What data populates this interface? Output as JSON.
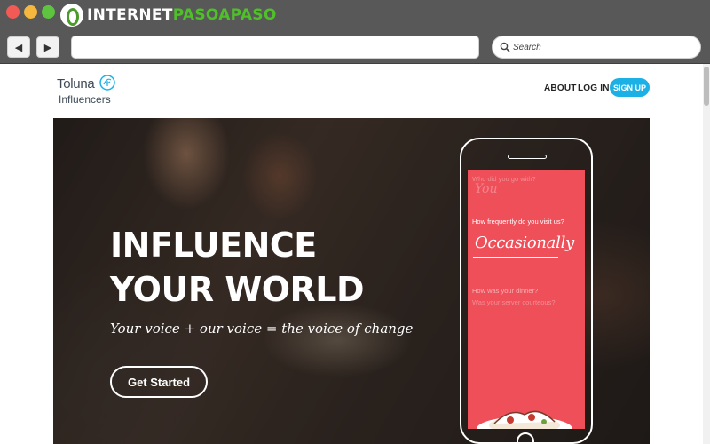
{
  "window": {
    "watermark_part1": "INTERNET",
    "watermark_part2": "PASOAPASO"
  },
  "toolbar": {
    "back_icon": "◀",
    "forward_icon": "▶",
    "address_value": "",
    "search_placeholder": "Search"
  },
  "header": {
    "logo_top": "Toluna",
    "logo_bottom": "Influencers",
    "nav": {
      "about": "ABOUT",
      "login": "LOG IN",
      "signup": "SIGN UP"
    }
  },
  "hero": {
    "title": "INFLUENCE YOUR WORLD",
    "subtitle": "Your voice + our voice = the voice of change",
    "cta": "Get Started"
  },
  "phone": {
    "q0": "Who did you go with?",
    "a0": "You",
    "q1": "How frequently do you visit us?",
    "a1": "Occasionally",
    "q2": "How was your dinner?",
    "q3": "Was your server courteous?"
  },
  "colors": {
    "accent": "#1bb1e6",
    "phone_screen": "#ef4f59",
    "watermark_green": "#4fbf2a"
  }
}
